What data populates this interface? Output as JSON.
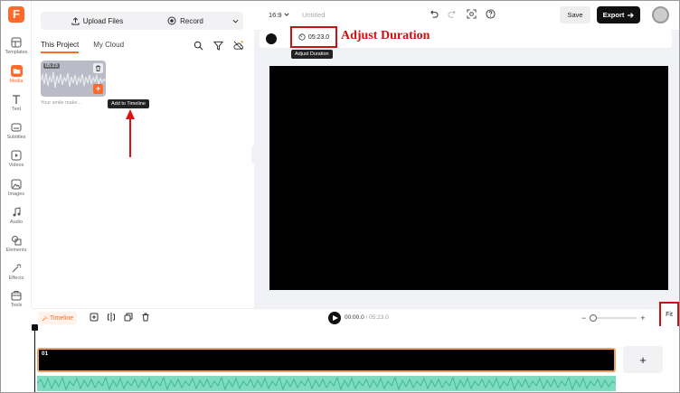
{
  "rail": {
    "items": [
      {
        "label": "Templates",
        "icon": "templates-icon"
      },
      {
        "label": "Media",
        "icon": "media-icon"
      },
      {
        "label": "Text",
        "icon": "text-icon"
      },
      {
        "label": "Subtitles",
        "icon": "subtitles-icon"
      },
      {
        "label": "Videos",
        "icon": "videos-icon"
      },
      {
        "label": "Images",
        "icon": "images-icon"
      },
      {
        "label": "Audio",
        "icon": "audio-icon"
      },
      {
        "label": "Elements",
        "icon": "elements-icon"
      },
      {
        "label": "Effects",
        "icon": "effects-icon"
      },
      {
        "label": "Tools",
        "icon": "tools-icon"
      }
    ],
    "active": "Media",
    "logo": "F"
  },
  "panel": {
    "upload_label": "Upload Files",
    "record_label": "Record",
    "tabs": [
      "This Project",
      "My Cloud"
    ],
    "active_tab": "This Project",
    "media": {
      "duration": "05:23",
      "name": "Your smile make..."
    },
    "add_tooltip": "Add to Timeline",
    "add_glyph": "+"
  },
  "topbar": {
    "ratio": "16:9",
    "title": "Untitled",
    "save_label": "Save",
    "export_label": "Export"
  },
  "preview": {
    "duration": "05:23.0",
    "duration_tooltip": "Adjust Duration",
    "annotation": "Adjust Duration"
  },
  "timeline": {
    "label": "Timeline",
    "current_time": "00:00.0",
    "separator": "/",
    "total_time": "05:23.0",
    "zoom_minus": "−",
    "zoom_plus": "+",
    "fit_label": "Fit",
    "clip_label": "01",
    "add_glyph": "+"
  },
  "colors": {
    "accent": "#ff6a2b",
    "annotation": "#cc1111",
    "audio_track": "#7fdcc1",
    "clip_border": "#f0a060"
  }
}
